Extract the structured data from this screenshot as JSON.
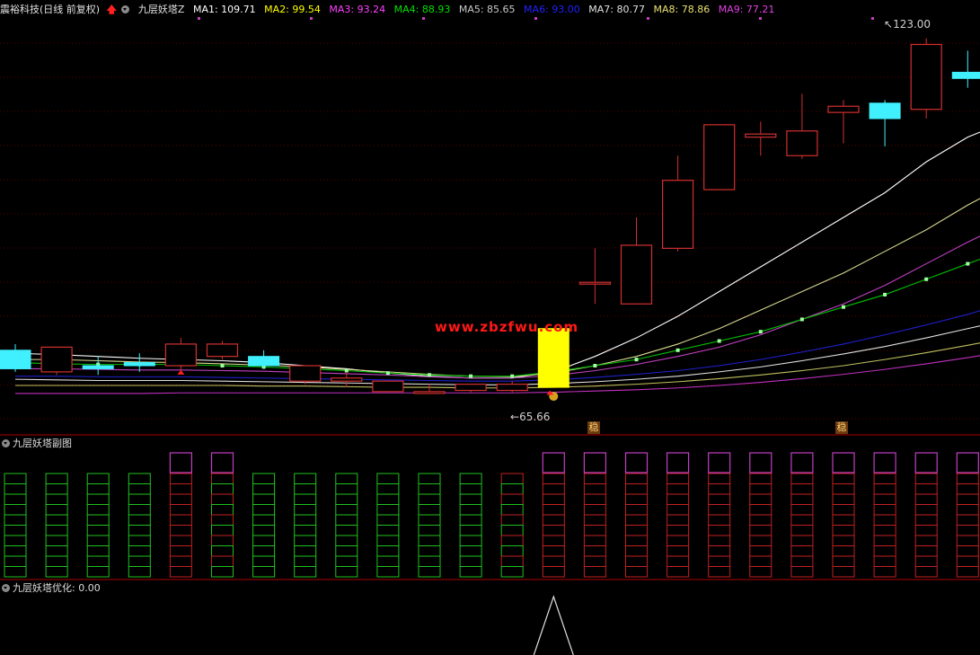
{
  "header": {
    "stock_name": "震裕科技(日线 前复权)",
    "indicator_name": "九层妖塔Z",
    "ma_items": [
      {
        "label": "MA1: 109.71",
        "color": "#ffffff"
      },
      {
        "label": "MA2: 99.54",
        "color": "#ffff00"
      },
      {
        "label": "MA3: 93.24",
        "color": "#ff40ff"
      },
      {
        "label": "MA4: 88.93",
        "color": "#00e000"
      },
      {
        "label": "MA5: 85.65",
        "color": "#c8c8c8"
      },
      {
        "label": "MA6: 93.00",
        "color": "#2020ff"
      },
      {
        "label": "MA7: 80.77",
        "color": "#e0e0e0"
      },
      {
        "label": "MA8: 78.86",
        "color": "#e8e070"
      },
      {
        "label": "MA9: 77.21",
        "color": "#e040e0"
      }
    ]
  },
  "sub1": {
    "title": "九层妖塔副图"
  },
  "sub2": {
    "title": "九层妖塔优化",
    "value": ": 0.00"
  },
  "watermark": "www.zbzfwu.com",
  "chart_data": {
    "type": "candlestick",
    "high_label": "123.00",
    "low_label": "65.66",
    "markers": [
      "稳",
      "稳"
    ],
    "ylim": [
      62,
      126
    ],
    "candles": [
      {
        "o": 72.5,
        "h": 73.5,
        "c": 69.5,
        "l": 69
      },
      {
        "o": 69,
        "h": 72.5,
        "c": 73,
        "l": 68.5
      },
      {
        "o": 70,
        "h": 71.5,
        "c": 69.5,
        "l": 68.5
      },
      {
        "o": 70.5,
        "h": 72,
        "c": 70,
        "l": 69
      },
      {
        "o": 70,
        "h": 74.5,
        "c": 73.5,
        "l": 69
      },
      {
        "o": 71.5,
        "h": 74,
        "c": 73.5,
        "l": 71
      },
      {
        "o": 71.5,
        "h": 72.5,
        "c": 70,
        "l": 69.5
      },
      {
        "o": 67.5,
        "h": 70,
        "c": 70,
        "l": 67
      },
      {
        "o": 67.5,
        "h": 69,
        "c": 68,
        "l": 66.5
      },
      {
        "o": 65.8,
        "h": 67.5,
        "c": 67.5,
        "l": 65.8
      },
      {
        "o": 65.8,
        "h": 67,
        "c": 65.8,
        "l": 65.7
      },
      {
        "o": 66,
        "h": 67,
        "c": 67,
        "l": 65.7
      },
      {
        "o": 66,
        "h": 67.5,
        "c": 67,
        "l": 65.66
      },
      {
        "o": 66.5,
        "h": 76,
        "c": 76,
        "l": 66.5
      },
      {
        "o": 83.5,
        "h": 89,
        "c": 83.5,
        "l": 80
      },
      {
        "o": 80,
        "h": 94,
        "c": 89.5,
        "l": 80
      },
      {
        "o": 89,
        "h": 104,
        "c": 100,
        "l": 88.5
      },
      {
        "o": 98.5,
        "h": 109,
        "c": 109,
        "l": 98.5
      },
      {
        "o": 107,
        "h": 109.5,
        "c": 107.5,
        "l": 104
      },
      {
        "o": 104,
        "h": 114,
        "c": 108,
        "l": 103.5
      },
      {
        "o": 111,
        "h": 113,
        "c": 112,
        "l": 106
      },
      {
        "o": 112.5,
        "h": 113,
        "c": 110,
        "l": 105.5
      },
      {
        "o": 111.5,
        "h": 123,
        "c": 122,
        "l": 110
      },
      {
        "o": 117.5,
        "h": 121,
        "c": 116.5,
        "l": 115
      },
      {
        "o": 118,
        "h": 120,
        "c": 112.5,
        "l": 111
      }
    ],
    "ma_series": [
      {
        "name": "MA1",
        "color": "#ffffff",
        "values": [
          72,
          71.8,
          71.5,
          71.2,
          71,
          70.8,
          70.5,
          70,
          69.5,
          68.8,
          68.3,
          68,
          68,
          69,
          71.5,
          74.5,
          78,
          82,
          86,
          90,
          94,
          98,
          103,
          107,
          109.71
        ]
      },
      {
        "name": "MA2",
        "color": "#d8d890",
        "values": [
          71,
          71,
          70.8,
          70.6,
          70.5,
          70.3,
          70.1,
          69.8,
          69.4,
          69,
          68.6,
          68.3,
          68.2,
          68.8,
          70,
          71.5,
          73.5,
          76,
          79,
          82,
          85,
          88.5,
          92,
          96,
          99.54
        ]
      },
      {
        "name": "MA3",
        "color": "#c040c0",
        "values": [
          69.5,
          69.5,
          69.4,
          69.3,
          69.3,
          69.2,
          69.1,
          68.9,
          68.7,
          68.5,
          68.2,
          68,
          68,
          68.4,
          69.2,
          70.2,
          71.5,
          73,
          75,
          77.5,
          80,
          83,
          86.5,
          90,
          93.24
        ]
      },
      {
        "name": "MA4",
        "color": "#00c000",
        "values": [
          70.5,
          70.3,
          70.2,
          70.2,
          70.2,
          70,
          69.8,
          69.5,
          69.2,
          68.8,
          68.5,
          68.3,
          68.3,
          69,
          70,
          71,
          72.5,
          74,
          75.5,
          77.5,
          79.5,
          81.5,
          84,
          86.5,
          88.93
        ]
      },
      {
        "name": "MA6",
        "color": "#2020d0",
        "values": [
          68.3,
          68.3,
          68.2,
          68.2,
          68.2,
          68.1,
          68,
          67.9,
          67.8,
          67.7,
          67.6,
          67.5,
          67.5,
          67.7,
          68.1,
          68.6,
          69.2,
          70,
          71,
          72.2,
          73.5,
          75,
          76.6,
          78.3,
          80.3
        ]
      },
      {
        "name": "MA5",
        "color": "#e0e0e0",
        "values": [
          67.8,
          67.7,
          67.6,
          67.6,
          67.6,
          67.5,
          67.4,
          67.3,
          67.2,
          67.1,
          67,
          66.9,
          66.9,
          67.1,
          67.4,
          67.8,
          68.3,
          69,
          69.8,
          70.8,
          71.9,
          73.1,
          74.5,
          76,
          77.5
        ]
      },
      {
        "name": "MA8",
        "color": "#c0c060",
        "values": [
          66.8,
          66.8,
          66.8,
          66.8,
          66.8,
          66.8,
          66.7,
          66.7,
          66.6,
          66.5,
          66.5,
          66.4,
          66.4,
          66.5,
          66.7,
          67,
          67.4,
          67.9,
          68.5,
          69.2,
          70,
          71,
          72.1,
          73.3,
          74.6
        ]
      },
      {
        "name": "MA9",
        "color": "#c030c0",
        "values": [
          65.5,
          65.5,
          65.5,
          65.5,
          65.6,
          65.6,
          65.6,
          65.6,
          65.6,
          65.6,
          65.6,
          65.6,
          65.6,
          65.7,
          65.9,
          66.1,
          66.4,
          66.8,
          67.3,
          67.9,
          68.6,
          69.4,
          70.3,
          71.3,
          72.4
        ]
      }
    ],
    "sub1_bars": [
      {
        "color": "green",
        "red_from": 10,
        "purple": false
      },
      {
        "color": "green",
        "red_from": 10,
        "purple": false
      },
      {
        "color": "green",
        "red_from": 10,
        "purple": false
      },
      {
        "color": "green",
        "red_from": 10,
        "purple": false
      },
      {
        "color": "red",
        "red_from": 0,
        "purple": true
      },
      {
        "color": "mix",
        "red_from": 5,
        "purple": true
      },
      {
        "color": "green",
        "red_from": 10,
        "purple": false
      },
      {
        "color": "green",
        "red_from": 10,
        "purple": false
      },
      {
        "color": "green",
        "red_from": 10,
        "purple": false
      },
      {
        "color": "green",
        "red_from": 10,
        "purple": false
      },
      {
        "color": "green",
        "red_from": 10,
        "purple": false
      },
      {
        "color": "green",
        "red_from": 10,
        "purple": false
      },
      {
        "color": "mix",
        "red_from": 0,
        "purple": false
      },
      {
        "color": "red",
        "red_from": 0,
        "purple": true
      },
      {
        "color": "red",
        "red_from": 0,
        "purple": true
      },
      {
        "color": "red",
        "red_from": 0,
        "purple": true
      },
      {
        "color": "red",
        "red_from": 0,
        "purple": true
      },
      {
        "color": "red",
        "red_from": 0,
        "purple": true
      },
      {
        "color": "red",
        "red_from": 0,
        "purple": true
      },
      {
        "color": "red",
        "red_from": 0,
        "purple": true
      },
      {
        "color": "red",
        "red_from": 0,
        "purple": true
      },
      {
        "color": "red",
        "red_from": 0,
        "purple": true
      },
      {
        "color": "red",
        "red_from": 0,
        "purple": true
      },
      {
        "color": "red",
        "red_from": 0,
        "purple": true
      },
      {
        "color": "green",
        "red_from": 10,
        "purple": true
      }
    ]
  }
}
